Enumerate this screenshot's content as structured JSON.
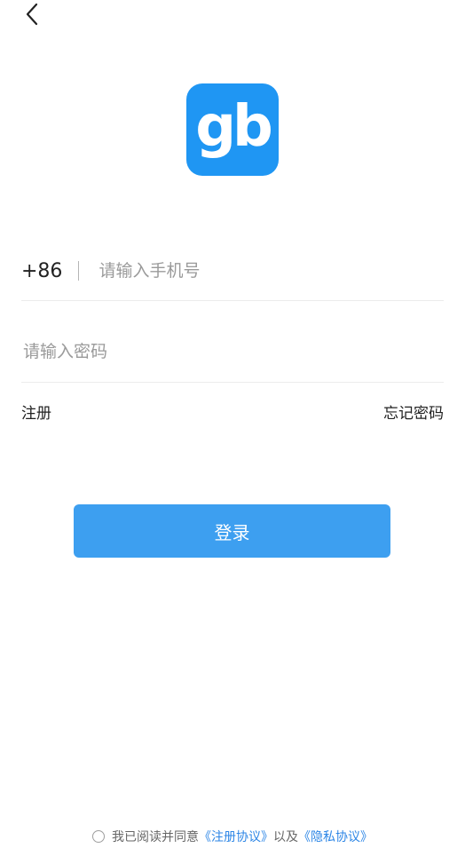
{
  "header": {
    "back_icon": "chevron-left-icon"
  },
  "logo": {
    "text": "gb",
    "color": "#1f96f3"
  },
  "phone": {
    "country_code": "+86",
    "placeholder": "请输入手机号"
  },
  "password": {
    "placeholder": "请输入密码"
  },
  "links": {
    "register": "注册",
    "forgot_password": "忘记密码"
  },
  "login": {
    "label": "登录",
    "color": "#3d9ff0"
  },
  "agreement": {
    "prefix": "我已阅读并同意",
    "terms": "《注册协议》",
    "joiner": "以及",
    "privacy": "《隐私协议》",
    "link_color": "#2d86e6"
  }
}
